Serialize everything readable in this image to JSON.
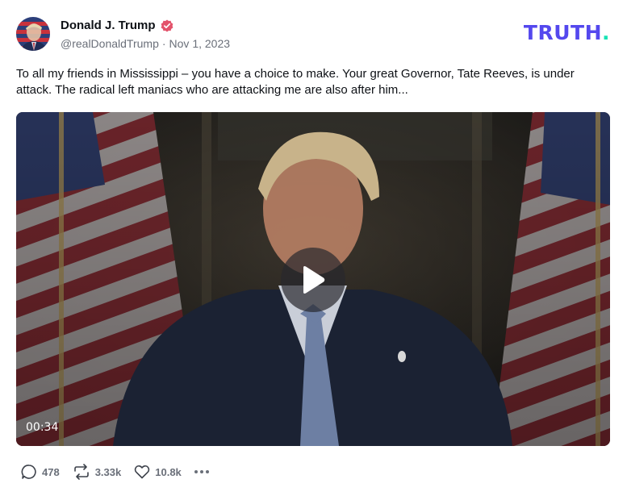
{
  "author": {
    "display_name": "Donald J. Trump",
    "handle": "@realDonaldTrump",
    "separator": "·",
    "date": "Nov 1, 2023",
    "verified": true,
    "avatar_icon": "flag-portrait-avatar"
  },
  "brand": {
    "wordmark": "TRUTH",
    "dot": ".",
    "color": "#5448ee",
    "dot_color": "#17e3b5"
  },
  "post": {
    "text": "To all my friends in Mississippi – you have a choice to make. Your great Governor, Tate Reeves, is under attack. The radical left maniacs who are attacking me are also after him..."
  },
  "video": {
    "duration": "00:34",
    "play_icon": "play-icon"
  },
  "actions": {
    "replies": "478",
    "retruths": "3.33k",
    "likes": "10.8k",
    "more_icon": "more-icon"
  },
  "colors": {
    "verified_badge": "#e3536b",
    "muted_text": "#6a6f79"
  }
}
